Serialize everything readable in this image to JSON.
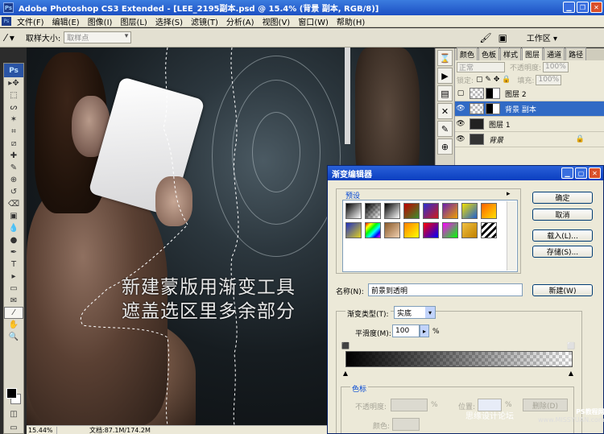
{
  "window": {
    "title": "Adobe Photoshop CS3 Extended - [LEE_2195副本.psd @ 15.4% (背景 副本, RGB/8)]",
    "app_badge": "Ps"
  },
  "menu": [
    "文件(F)",
    "编辑(E)",
    "图像(I)",
    "图层(L)",
    "选择(S)",
    "滤镜(T)",
    "分析(A)",
    "视图(V)",
    "窗口(W)",
    "帮助(H)"
  ],
  "options_bar": {
    "sample_size_label": "取样大小:",
    "sample_size_value": "取样点",
    "workspace_label": "工作区 ▾"
  },
  "toolbox": {
    "logo": "Ps",
    "tools": [
      "move-icon",
      "marquee-icon",
      "lasso-icon",
      "magic-wand-icon",
      "crop-icon",
      "slice-icon",
      "healing-brush-icon",
      "brush-icon",
      "clone-stamp-icon",
      "history-brush-icon",
      "eraser-icon",
      "gradient-icon",
      "blur-icon",
      "dodge-icon",
      "pen-icon",
      "type-icon",
      "path-selection-icon",
      "shape-icon",
      "notes-icon",
      "eyedropper-icon",
      "hand-icon",
      "zoom-icon"
    ],
    "tool_glyphs": [
      "▸✥",
      "⬚",
      "ᔕ",
      "✶",
      "⌗",
      "⧄",
      "✚",
      "✎",
      "⊕",
      "↺",
      "⌫",
      "▣",
      "💧",
      "●",
      "✒",
      "T",
      "▸",
      "▭",
      "✉",
      "⁄",
      "✋",
      "🔍"
    ]
  },
  "canvas": {
    "overlay_line1": "新建蒙版用渐变工具",
    "overlay_line2": "遮盖选区里多余部分"
  },
  "status_bar": {
    "zoom": "15.44%",
    "doc": "文档:87.1M/174.2M"
  },
  "layers_panel": {
    "tabs": [
      "颜色",
      "色板",
      "样式",
      "图层",
      "通道",
      "路径"
    ],
    "active_tab": "图层",
    "blend_mode": "正常",
    "opacity_label": "不透明度:",
    "opacity_value": "100%",
    "lock_label": "锁定:",
    "fill_label": "填充:",
    "fill_value": "100%",
    "layers": [
      {
        "name": "图层 2",
        "visible": false,
        "selected": false
      },
      {
        "name": "背景 副本",
        "visible": true,
        "selected": true
      },
      {
        "name": "图层 1",
        "visible": true,
        "selected": false
      },
      {
        "name": "背景",
        "visible": true,
        "selected": false
      }
    ]
  },
  "gradient_editor": {
    "title": "渐变编辑器",
    "presets_label": "预设",
    "buttons": {
      "ok": "确定",
      "cancel": "取消",
      "load": "载入(L)...",
      "save": "存储(S)...",
      "new": "新建(W)"
    },
    "name_label": "名称(N):",
    "name_value": "前景到透明",
    "type_label": "渐变类型(T):",
    "type_value": "实底",
    "smoothness_label": "平滑度(M):",
    "smoothness_value": "100",
    "smoothness_unit": "%",
    "color_stops_label": "色标",
    "opacity_label": "不透明度:",
    "location_label": "位置:",
    "delete_label": "删除(D)",
    "color_label": "颜色:",
    "percent": "%",
    "preset_colors": [
      [
        "#000000",
        "#ffffff"
      ],
      [
        "#000000",
        "#ffffff00"
      ],
      [
        "#000000",
        "#ffffff"
      ],
      [
        "#c00000",
        "#3a8f2a"
      ],
      [
        "#2b2fd1",
        "#d01a1a"
      ],
      [
        "#6a1fb0",
        "#f0a000"
      ],
      [
        "#f2e000",
        "#2060d0"
      ],
      [
        "#ff6000",
        "#ffe000"
      ],
      [
        "#2030c0",
        "#e0d020"
      ],
      [
        "#ff0000",
        "#00c0ff"
      ],
      [
        "#8a5a2a",
        "#f0d0b0"
      ],
      [
        "#ff8000",
        "#ffff00"
      ],
      [
        "#ff0000",
        "#0000ff"
      ],
      [
        "#ff00ff",
        "#00ff00"
      ],
      [
        "#f0c040",
        "#c08000"
      ],
      [
        "#ffffff",
        "#000000"
      ]
    ]
  },
  "watermark": {
    "text": "思缘设计论坛",
    "site_top": "PS教程网",
    "site_bottom": "www.MISSYUAN.com"
  }
}
